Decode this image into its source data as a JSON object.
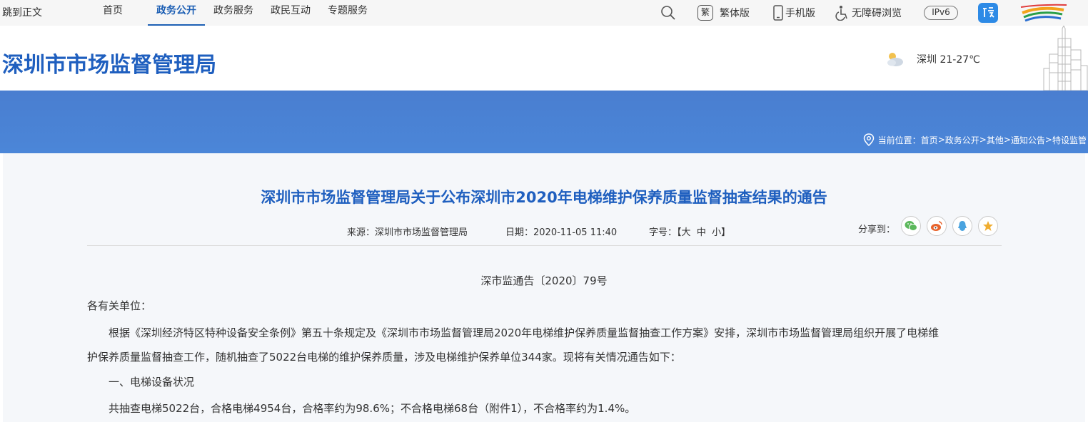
{
  "topbar": {
    "skip_label": "跳到正文",
    "nav": [
      {
        "label": "首页",
        "active": false
      },
      {
        "label": "政务公开",
        "active": true
      },
      {
        "label": "政务服务",
        "active": false
      },
      {
        "label": "政民互动",
        "active": false
      },
      {
        "label": "专题服务",
        "active": false
      }
    ],
    "traditional_label": "繁体版",
    "traditional_icon_char": "繁",
    "mobile_label": "手机版",
    "accessibility_label": "无障碍浏览",
    "ipv6_label": "IPv6"
  },
  "header": {
    "site_title": "深圳市市场监督管理局",
    "weather": "深圳 21-27℃"
  },
  "breadcrumb": {
    "prefix": "当前位置：",
    "items": [
      "首页",
      "政务公开",
      "其他",
      "通知公告",
      "特设监管"
    ],
    "separator": " > "
  },
  "article": {
    "title": "深圳市市场监督管理局关于公布深圳市2020年电梯维护保养质量监督抽查结果的通告",
    "source_label": "来源：",
    "source": "深圳市市场监督管理局",
    "date_label": "日期：",
    "date": "2020-11-05 11:40",
    "font_label": "字号：",
    "font_open": "【",
    "font_large": "大",
    "font_medium": "中",
    "font_small": "小",
    "font_close": "】",
    "share_label": "分享到：",
    "doc_number": "深市监通告〔2020〕79号",
    "salutation": "各有关单位：",
    "para1_line1": "根据《深圳经济特区特种设备安全条例》第五十条规定及《深圳市市场监督管理局2020年电梯维护保养质量监督抽查工作方案》安排，深圳市市场监督管理局组织开展了电梯维",
    "para1_line2": "护保养质量监督抽查工作，随机抽查了5022台电梯的维护保养质量，涉及电梯维护保养单位344家。现将有关情况通告如下：",
    "section1": "一、电梯设备状况",
    "section1_text": "共抽查电梯5022台，合格电梯4954台，合格率约为98.6%；不合格电梯68台（附件1），不合格率约为1.4%。"
  },
  "colors": {
    "brand_blue": "#1f5fbf",
    "band_blue": "#4b86d8",
    "wechat": "#5cb85c",
    "weibo": "#e8632c",
    "qq": "#4aa3df",
    "favorite": "#f0ad30"
  }
}
